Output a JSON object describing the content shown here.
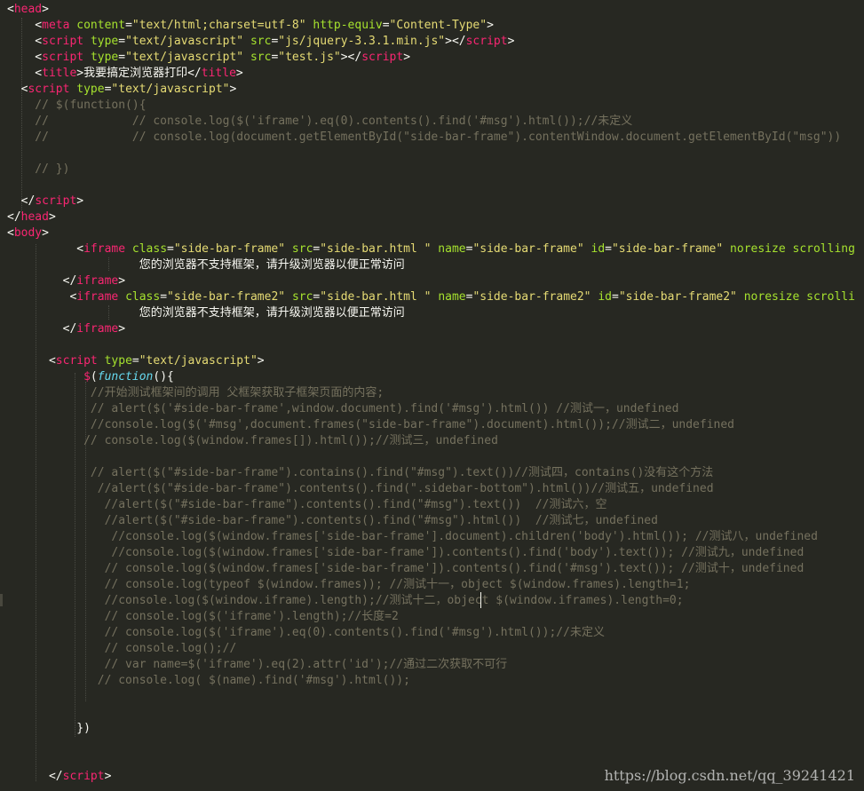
{
  "editor": {
    "lines": [
      {
        "tokens": [
          {
            "c": "p",
            "t": "<"
          },
          {
            "c": "t",
            "t": "head"
          },
          {
            "c": "p",
            "t": ">"
          }
        ]
      },
      {
        "tokens": [
          {
            "c": "p",
            "t": "    <"
          },
          {
            "c": "t",
            "t": "meta"
          },
          {
            "c": "p",
            "t": " "
          },
          {
            "c": "a",
            "t": "content"
          },
          {
            "c": "p",
            "t": "="
          },
          {
            "c": "s",
            "t": "\"text/html;charset=utf-8\""
          },
          {
            "c": "p",
            "t": " "
          },
          {
            "c": "a",
            "t": "http-equiv"
          },
          {
            "c": "p",
            "t": "="
          },
          {
            "c": "s",
            "t": "\"Content-Type\""
          },
          {
            "c": "p",
            "t": ">"
          }
        ]
      },
      {
        "tokens": [
          {
            "c": "p",
            "t": "    <"
          },
          {
            "c": "t",
            "t": "script"
          },
          {
            "c": "p",
            "t": " "
          },
          {
            "c": "a",
            "t": "type"
          },
          {
            "c": "p",
            "t": "="
          },
          {
            "c": "s",
            "t": "\"text/javascript\""
          },
          {
            "c": "p",
            "t": " "
          },
          {
            "c": "a",
            "t": "src"
          },
          {
            "c": "p",
            "t": "="
          },
          {
            "c": "s",
            "t": "\"js/jquery-3.3.1.min.js\""
          },
          {
            "c": "p",
            "t": "></"
          },
          {
            "c": "t",
            "t": "script"
          },
          {
            "c": "p",
            "t": ">"
          }
        ]
      },
      {
        "tokens": [
          {
            "c": "p",
            "t": "    <"
          },
          {
            "c": "t",
            "t": "script"
          },
          {
            "c": "p",
            "t": " "
          },
          {
            "c": "a",
            "t": "type"
          },
          {
            "c": "p",
            "t": "="
          },
          {
            "c": "s",
            "t": "\"text/javascript\""
          },
          {
            "c": "p",
            "t": " "
          },
          {
            "c": "a",
            "t": "src"
          },
          {
            "c": "p",
            "t": "="
          },
          {
            "c": "s",
            "t": "\"test.js\""
          },
          {
            "c": "p",
            "t": "></"
          },
          {
            "c": "t",
            "t": "script"
          },
          {
            "c": "p",
            "t": ">"
          }
        ]
      },
      {
        "tokens": [
          {
            "c": "p",
            "t": "    <"
          },
          {
            "c": "t",
            "t": "title"
          },
          {
            "c": "p",
            "t": ">我要搞定浏览器打印</"
          },
          {
            "c": "t",
            "t": "title"
          },
          {
            "c": "p",
            "t": ">"
          }
        ]
      },
      {
        "tokens": [
          {
            "c": "p",
            "t": "  <"
          },
          {
            "c": "t",
            "t": "script"
          },
          {
            "c": "p",
            "t": " "
          },
          {
            "c": "a",
            "t": "type"
          },
          {
            "c": "p",
            "t": "="
          },
          {
            "c": "s",
            "t": "\"text/javascript\""
          },
          {
            "c": "p",
            "t": ">"
          }
        ]
      },
      {
        "tokens": [
          {
            "c": "c",
            "t": "    // $(function(){"
          }
        ]
      },
      {
        "tokens": [
          {
            "c": "c",
            "t": "    //            // console.log($('iframe').eq(0).contents().find('#msg').html());//未定义"
          }
        ]
      },
      {
        "tokens": [
          {
            "c": "c",
            "t": "    //            // console.log(document.getElementById(\"side-bar-frame\").contentWindow.document.getElementById(\"msg\"))"
          }
        ]
      },
      {
        "tokens": []
      },
      {
        "tokens": [
          {
            "c": "c",
            "t": "    // })"
          }
        ]
      },
      {
        "tokens": []
      },
      {
        "tokens": [
          {
            "c": "p",
            "t": "  </"
          },
          {
            "c": "t",
            "t": "script"
          },
          {
            "c": "p",
            "t": ">"
          }
        ]
      },
      {
        "tokens": [
          {
            "c": "p",
            "t": "</"
          },
          {
            "c": "t",
            "t": "head"
          },
          {
            "c": "p",
            "t": ">"
          }
        ]
      },
      {
        "tokens": [
          {
            "c": "p",
            "t": "<"
          },
          {
            "c": "t",
            "t": "body"
          },
          {
            "c": "p",
            "t": ">"
          }
        ]
      },
      {
        "tokens": [
          {
            "c": "p",
            "t": "          <"
          },
          {
            "c": "t",
            "t": "iframe"
          },
          {
            "c": "p",
            "t": " "
          },
          {
            "c": "a",
            "t": "class"
          },
          {
            "c": "p",
            "t": "="
          },
          {
            "c": "s",
            "t": "\"side-bar-frame\""
          },
          {
            "c": "p",
            "t": " "
          },
          {
            "c": "a",
            "t": "src"
          },
          {
            "c": "p",
            "t": "="
          },
          {
            "c": "s",
            "t": "\"side-bar.html \""
          },
          {
            "c": "p",
            "t": " "
          },
          {
            "c": "a",
            "t": "name"
          },
          {
            "c": "p",
            "t": "="
          },
          {
            "c": "s",
            "t": "\"side-bar-frame\""
          },
          {
            "c": "p",
            "t": " "
          },
          {
            "c": "a",
            "t": "id"
          },
          {
            "c": "p",
            "t": "="
          },
          {
            "c": "s",
            "t": "\"side-bar-frame\""
          },
          {
            "c": "p",
            "t": " "
          },
          {
            "c": "a",
            "t": "noresize scrolling"
          }
        ]
      },
      {
        "tokens": [
          {
            "c": "p",
            "t": "                   您的浏览器不支持框架，请升级浏览器以便正常访问"
          }
        ]
      },
      {
        "tokens": [
          {
            "c": "p",
            "t": "        </"
          },
          {
            "c": "t",
            "t": "iframe"
          },
          {
            "c": "p",
            "t": ">"
          }
        ]
      },
      {
        "tokens": [
          {
            "c": "p",
            "t": "         <"
          },
          {
            "c": "t",
            "t": "iframe"
          },
          {
            "c": "p",
            "t": " "
          },
          {
            "c": "a",
            "t": "class"
          },
          {
            "c": "p",
            "t": "="
          },
          {
            "c": "s",
            "t": "\"side-bar-frame2\""
          },
          {
            "c": "p",
            "t": " "
          },
          {
            "c": "a",
            "t": "src"
          },
          {
            "c": "p",
            "t": "="
          },
          {
            "c": "s",
            "t": "\"side-bar.html \""
          },
          {
            "c": "p",
            "t": " "
          },
          {
            "c": "a",
            "t": "name"
          },
          {
            "c": "p",
            "t": "="
          },
          {
            "c": "s",
            "t": "\"side-bar-frame2\""
          },
          {
            "c": "p",
            "t": " "
          },
          {
            "c": "a",
            "t": "id"
          },
          {
            "c": "p",
            "t": "="
          },
          {
            "c": "s",
            "t": "\"side-bar-frame2\""
          },
          {
            "c": "p",
            "t": " "
          },
          {
            "c": "a",
            "t": "noresize scrolli"
          }
        ]
      },
      {
        "tokens": [
          {
            "c": "p",
            "t": "                   您的浏览器不支持框架，请升级浏览器以便正常访问"
          }
        ]
      },
      {
        "tokens": [
          {
            "c": "p",
            "t": "        </"
          },
          {
            "c": "t",
            "t": "iframe"
          },
          {
            "c": "p",
            "t": ">"
          }
        ]
      },
      {
        "tokens": []
      },
      {
        "tokens": [
          {
            "c": "p",
            "t": "      <"
          },
          {
            "c": "t",
            "t": "script"
          },
          {
            "c": "p",
            "t": " "
          },
          {
            "c": "a",
            "t": "type"
          },
          {
            "c": "p",
            "t": "="
          },
          {
            "c": "s",
            "t": "\"text/javascript\""
          },
          {
            "c": "p",
            "t": ">"
          }
        ]
      },
      {
        "tokens": [
          {
            "c": "p",
            "t": "           "
          },
          {
            "c": "t",
            "t": "$"
          },
          {
            "c": "p",
            "t": "("
          },
          {
            "c": "f",
            "t": "function"
          },
          {
            "c": "p",
            "t": "(){"
          }
        ]
      },
      {
        "tokens": [
          {
            "c": "c",
            "t": "            //开始测试框架间的调用 父框架获取子框架页面的内容;"
          }
        ]
      },
      {
        "tokens": [
          {
            "c": "c",
            "t": "            // alert($('#side-bar-frame',window.document).find('#msg').html()) //测试一，undefined"
          }
        ]
      },
      {
        "tokens": [
          {
            "c": "c",
            "t": "            //console.log($('#msg',document.frames(\"side-bar-frame\").document).html());//测试二，undefined"
          }
        ]
      },
      {
        "tokens": [
          {
            "c": "c",
            "t": "           // console.log($(window.frames[]).html());//测试三，undefined"
          }
        ]
      },
      {
        "tokens": []
      },
      {
        "tokens": [
          {
            "c": "c",
            "t": "            // alert($(\"#side-bar-frame\").contains().find(\"#msg\").text())//测试四，contains()没有这个方法"
          }
        ]
      },
      {
        "tokens": [
          {
            "c": "c",
            "t": "             //alert($(\"#side-bar-frame\").contents().find(\".sidebar-bottom\").html())//测试五，undefined"
          }
        ]
      },
      {
        "tokens": [
          {
            "c": "c",
            "t": "              //alert($(\"#side-bar-frame\").contents().find(\"#msg\").text())  //测试六，空"
          }
        ]
      },
      {
        "tokens": [
          {
            "c": "c",
            "t": "              //alert($(\"#side-bar-frame\").contents().find(\"#msg\").html())  //测试七，undefined"
          }
        ]
      },
      {
        "tokens": [
          {
            "c": "c",
            "t": "               //console.log($(window.frames['side-bar-frame'].document).children('body').html()); //测试八，undefined"
          }
        ]
      },
      {
        "tokens": [
          {
            "c": "c",
            "t": "               //console.log($(window.frames['side-bar-frame']).contents().find('body').text()); //测试九，undefined"
          }
        ]
      },
      {
        "tokens": [
          {
            "c": "c",
            "t": "              // console.log($(window.frames['side-bar-frame']).contents().find('#msg').text()); //测试十，undefined"
          }
        ]
      },
      {
        "tokens": [
          {
            "c": "c",
            "t": "              // console.log(typeof $(window.frames)); //测试十一，object $(window.frames).length=1;"
          }
        ]
      },
      {
        "tokens": [
          {
            "c": "c",
            "t": "              //console.log($(window.iframe).length);//测试十二，object $(window.iframes).length=0;"
          }
        ]
      },
      {
        "tokens": [
          {
            "c": "c",
            "t": "              // console.log($('iframe').length);//长度=2"
          }
        ]
      },
      {
        "tokens": [
          {
            "c": "c",
            "t": "              // console.log($('iframe').eq(0).contents().find('#msg').html());//未定义"
          }
        ]
      },
      {
        "tokens": [
          {
            "c": "c",
            "t": "              // console.log();//"
          }
        ]
      },
      {
        "tokens": [
          {
            "c": "c",
            "t": "              // var name=$('iframe').eq(2).attr('id');//通过二次获取不可行"
          }
        ]
      },
      {
        "tokens": [
          {
            "c": "c",
            "t": "             // console.log( $(name).find('#msg').html());"
          }
        ]
      },
      {
        "tokens": []
      },
      {
        "tokens": []
      },
      {
        "tokens": [
          {
            "c": "p",
            "t": "          })"
          }
        ]
      },
      {
        "tokens": []
      },
      {
        "tokens": []
      },
      {
        "tokens": [
          {
            "c": "p",
            "t": "      </"
          },
          {
            "c": "t",
            "t": "script"
          },
          {
            "c": "p",
            "t": ">"
          }
        ]
      }
    ]
  },
  "watermark": "https://blog.csdn.net/qq_39241421"
}
